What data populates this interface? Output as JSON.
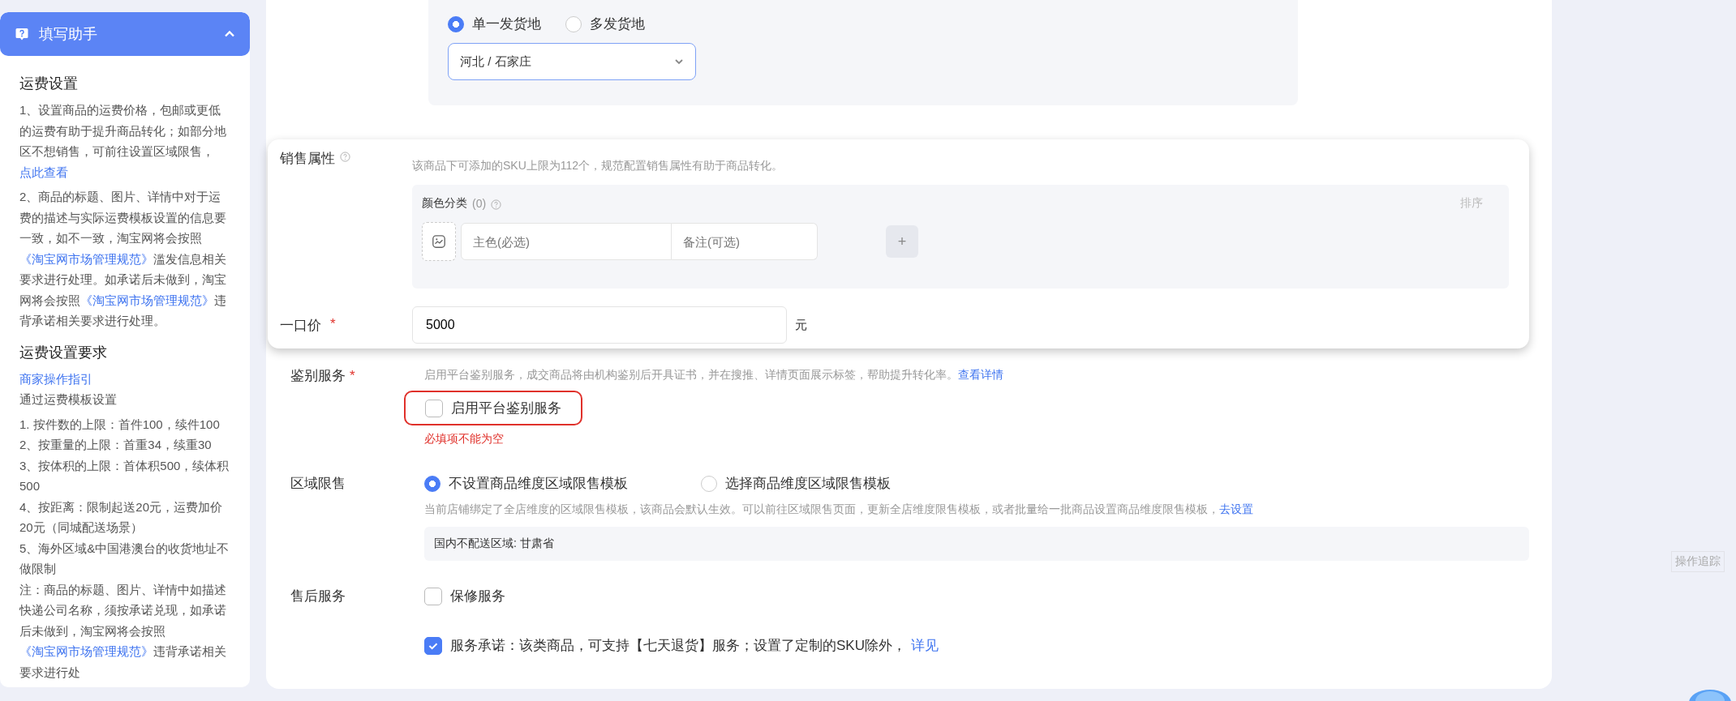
{
  "helper": {
    "title": "填写助手",
    "expanded": true,
    "sections": [
      {
        "heading": "运费设置",
        "paragraphs": [
          [
            {
              "text": "1、设置商品的运费价格，包邮或更低的运费有助于提升商品转化；如部分地区不想销售，可前往设置区域限售，",
              "link": false
            },
            {
              "text": "点此查看",
              "link": true
            }
          ],
          [
            {
              "text": "2、商品的标题、图片、详情中对于运费的描述与实际运费模板设置的信息要一致，如不一致，淘宝网将会按照",
              "link": false
            },
            {
              "text": "《淘宝网市场管理规范》",
              "link": true
            },
            {
              "text": "滥发信息相关要求进行处理。如承诺后未做到，淘宝网将会按照",
              "link": false
            },
            {
              "text": "《淘宝网市场管理规范》",
              "link": true
            },
            {
              "text": "违背承诺相关要求进行处理。",
              "link": false
            }
          ]
        ]
      },
      {
        "heading": "运费设置要求",
        "paragraphs": [
          [
            {
              "text": "商家操作指引",
              "link": true
            }
          ],
          [
            {
              "text": "通过运费模板设置",
              "link": false
            }
          ],
          [
            {
              "text": "1. 按件数的上限：首件100，续件100",
              "link": false
            }
          ],
          [
            {
              "text": "2、按重量的上限：首重34，续重30",
              "link": false
            }
          ],
          [
            {
              "text": "3、按体积的上限：首体积500，续体积500",
              "link": false
            }
          ],
          [
            {
              "text": "4、按距离：限制起送20元，运费加价20元（同城配送场景）",
              "link": false
            }
          ],
          [
            {
              "text": "5、海外区域&中国港澳台的收货地址不做限制",
              "link": false
            }
          ],
          [
            {
              "text": "注：商品的标题、图片、详情中如描述快递公司名称，须按承诺兑现，如承诺后未做到，淘宝网将会按照",
              "link": false
            },
            {
              "text": "《淘宝网市场管理规范》",
              "link": true
            },
            {
              "text": "违背承诺相关要求进行处",
              "link": false
            }
          ]
        ]
      }
    ]
  },
  "shipping_origin": {
    "options": [
      {
        "label": "单一发货地",
        "selected": true
      },
      {
        "label": "多发货地",
        "selected": false
      }
    ],
    "select": {
      "value": "河北 / 石家庄"
    }
  },
  "sales_popup": {
    "label": "销售属性",
    "hint": "该商品下可添加的SKU上限为112个，规范配置销售属性有助于商品转化。",
    "group": {
      "title": "颜色分类",
      "count": "(0)",
      "sort": "排序",
      "fields": [
        {
          "placeholder": "主色(必选)"
        },
        {
          "placeholder": "备注(可选)"
        }
      ],
      "add_button": "+"
    },
    "price": {
      "label": "一口价",
      "required_mark": "*",
      "value": "5000",
      "unit": "元"
    }
  },
  "authentication": {
    "label": "鉴别服务",
    "required_mark": "*",
    "hint": "启用平台鉴别服务，成交商品将由机构鉴别后开具证书，并在搜推、详情页面展示标签，帮助提升转化率。",
    "hint_link": "查看详情",
    "checkbox": {
      "label": "启用平台鉴别服务",
      "checked": false,
      "error": true
    },
    "error": "必填项不能为空"
  },
  "region": {
    "label": "区域限售",
    "options": [
      {
        "label": "不设置商品维度区域限售模板",
        "selected": true
      },
      {
        "label": "选择商品维度区域限售模板",
        "selected": false
      }
    ],
    "hint": "当前店铺绑定了全店维度的区域限售模板，该商品会默认生效。可以前往区域限售页面，更新全店维度限售模板，或者批量给一批商品设置商品维度限售模板，",
    "hint_link": "去设置",
    "note": "国内不配送区域: 甘肃省"
  },
  "after_sales": {
    "label": "售后服务",
    "items": [
      {
        "label": "保修服务",
        "checked": false
      },
      {
        "label": "服务承诺：该类商品，可支持【七天退货】服务；设置了定制的SKU除外，",
        "link": "详见",
        "checked": true
      }
    ]
  },
  "side_tab": "操作追踪"
}
